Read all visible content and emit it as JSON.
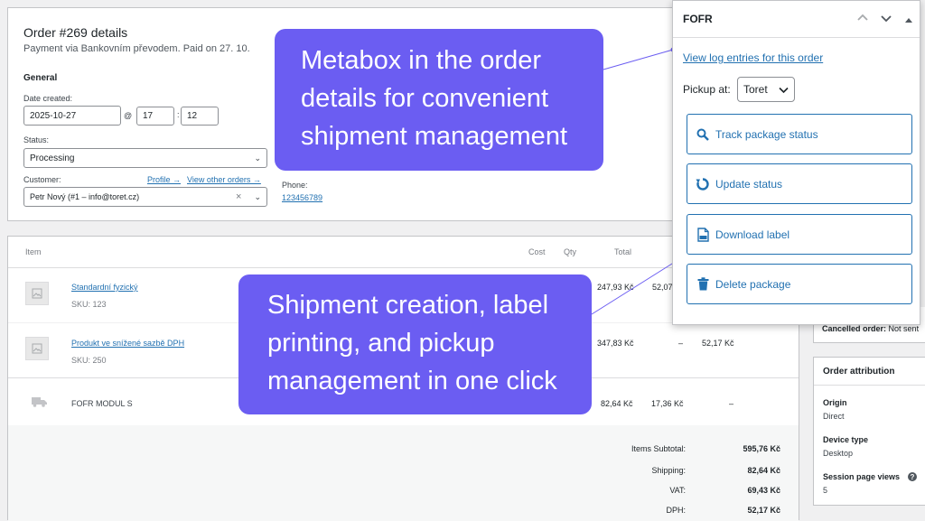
{
  "order": {
    "title": "Order #269 details",
    "subtitle": "Payment via Bankovním převodem. Paid on 27. 10.",
    "general_heading": "General",
    "date_created_label": "Date created:",
    "date_value": "2025-10-27",
    "at_symbol": "@",
    "hour": "17",
    "minute": "12",
    "status_label": "Status:",
    "status_value": "Processing",
    "customer_label": "Customer:",
    "profile_link": "Profile →",
    "view_orders_link": "View other orders →",
    "customer_value": "Petr Nový (#1 – info@toret.cz)",
    "clear_symbol": "×",
    "phone_label": "Phone:",
    "phone_value": "123456789"
  },
  "items": {
    "headers": {
      "item": "Item",
      "cost": "Cost",
      "qty": "Qty",
      "total": "Total"
    },
    "rows": [
      {
        "name": "Standardní fyzický",
        "sku": "SKU: 123",
        "total": "247,93 Kč",
        "tax": "52,07"
      },
      {
        "name": "Produkt ve snížené sazbě DPH",
        "sku": "SKU: 250",
        "total": "347,83 Kč",
        "dash": "–",
        "tax": "52,17 Kč"
      }
    ],
    "shipping": {
      "name": "FOFR MODUL S",
      "total": "82,64 Kč",
      "tax": "17,36 Kč",
      "dash": "–"
    }
  },
  "totals": [
    {
      "label": "Items Subtotal:",
      "value": "595,76 Kč"
    },
    {
      "label": "Shipping:",
      "value": "82,64 Kč"
    },
    {
      "label": "VAT:",
      "value": "69,43 Kč"
    },
    {
      "label": "DPH:",
      "value": "52,17 Kč"
    }
  ],
  "fofr": {
    "title": "FOFR",
    "log_link": "View log entries for this order",
    "pickup_label": "Pickup at:",
    "pickup_value": "Toret",
    "buttons": {
      "track": "Track package status",
      "update": "Update status",
      "download": "Download label",
      "delete": "Delete package"
    }
  },
  "sidebar": {
    "cancelled_label": "Cancelled order:",
    "cancelled_value": "Not sent",
    "attribution_title": "Order attribution",
    "origin_label": "Origin",
    "origin_value": "Direct",
    "device_label": "Device type",
    "device_value": "Desktop",
    "session_label": "Session page views",
    "session_value": "5"
  },
  "callouts": {
    "top": [
      "Metabox in the order",
      "details for convenient",
      "shipment management"
    ],
    "bottom": [
      "Shipment creation, label",
      "printing, and pickup",
      "management in one click"
    ]
  },
  "colors": {
    "callout_bg": "#6b5df2",
    "link_blue": "#2271b1",
    "page_bg": "#f0f0f1"
  }
}
